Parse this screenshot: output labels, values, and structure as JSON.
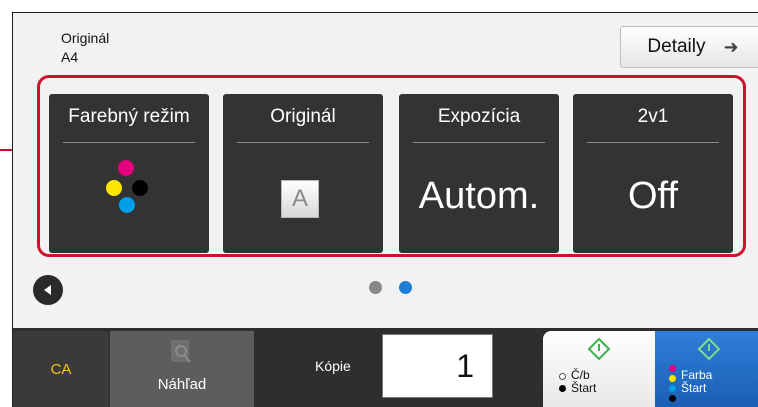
{
  "header": {
    "original_label": "Originál",
    "original_size": "A4",
    "details_button": "Detaily"
  },
  "tiles": [
    {
      "title": "Farebný režim",
      "icon": "color-mode-icon"
    },
    {
      "title": "Originál",
      "value": "A"
    },
    {
      "title": "Expozícia",
      "value": "Autom."
    },
    {
      "title": "2v1",
      "value": "Off"
    }
  ],
  "pager": {
    "pages": 2,
    "active_page": 2
  },
  "bottom": {
    "ca_label": "CA",
    "preview_label": "Náhľad",
    "copies_label": "Kópie",
    "copies_value": "1",
    "start_bw_label_line1": "Č/b",
    "start_bw_label_line2": "Štart",
    "start_color_label_line1": "Farba",
    "start_color_label_line2": "Štart"
  },
  "colors": {
    "highlight": "#d0112b",
    "tile_bg": "#333333",
    "active_dot": "#1f7fd6",
    "inactive_dot": "#888888",
    "ca_text": "#f3c21b",
    "start_color_bg": "#1b5fb5",
    "toner_magenta": "#e4007f",
    "toner_yellow": "#ffe600",
    "toner_cyan": "#00a0e9",
    "toner_black": "#000000"
  }
}
